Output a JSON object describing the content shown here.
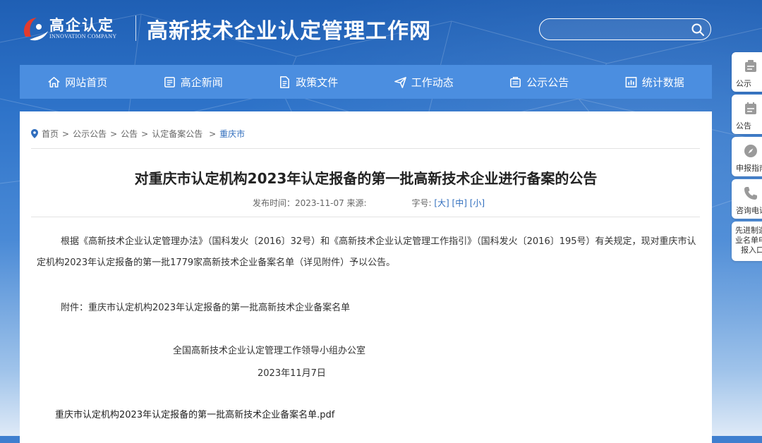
{
  "header": {
    "logo_text": "高企认定",
    "logo_sub": "INNOVATION COMPANY",
    "site_title": "高新技术企业认定管理工作网",
    "search_placeholder": ""
  },
  "nav": {
    "items": [
      {
        "label": "网站首页",
        "icon": "home-icon"
      },
      {
        "label": "高企新闻",
        "icon": "news-icon"
      },
      {
        "label": "政策文件",
        "icon": "document-icon"
      },
      {
        "label": "工作动态",
        "icon": "send-icon"
      },
      {
        "label": "公示公告",
        "icon": "notice-icon"
      },
      {
        "label": "统计数据",
        "icon": "chart-icon"
      }
    ]
  },
  "breadcrumb": {
    "items": [
      "首页",
      "公示公告",
      "公告",
      "认定备案公告"
    ],
    "current": "重庆市"
  },
  "article": {
    "title": "对重庆市认定机构2023年认定报备的第一批高新技术企业进行备案的公告",
    "meta_publish": "发布时间：2023-11-07 来源:",
    "meta_fontsize_label": "字号:",
    "font_large": "[大]",
    "font_medium": "[中]",
    "font_small": "[小]",
    "paragraph": "根据《高新技术企业认定管理办法》（国科发火〔2016〕32号）和《高新技术企业认定管理工作指引》（国科发火〔2016〕195号）有关规定，现对重庆市认定机构2023年认定报备的第一批1779家高新技术企业备案名单（详见附件）予以公告。",
    "attachment_line": "附件：重庆市认定机构2023年认定报备的第一批高新技术企业备案名单",
    "signature_org": "全国高新技术企业认定管理工作领导小组办公室",
    "signature_date": "2023年11月7日",
    "pdf_link": "重庆市认定机构2023年认定报备的第一批高新技术企业备案名单.pdf"
  },
  "sidebar": {
    "items": [
      "公示",
      "公告",
      "申报指南",
      "咨询电话"
    ],
    "last_item_lines": [
      "先进制造",
      "业名单申",
      "报入口"
    ]
  },
  "colors": {
    "nav_bg": "#4b8ee0",
    "link_blue": "#2f6dbd",
    "logo_red": "#e23b2e"
  }
}
